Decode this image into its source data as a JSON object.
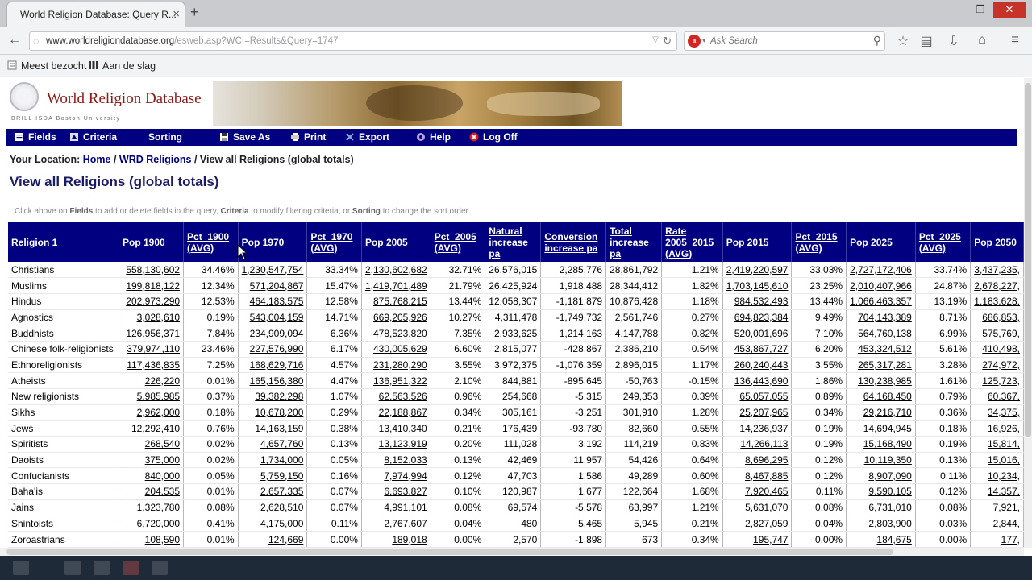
{
  "browser": {
    "tab_title": "World Religion Database: Query R...",
    "url_main": "www.worldreligiondatabase.org",
    "url_rest": "/esweb.asp?WCI=Results&Query=1747",
    "search_placeholder": "Ask Search",
    "bookmarks": [
      "Meest bezocht",
      "Aan de slag"
    ]
  },
  "site": {
    "title": "World Religion Database",
    "sub": "BRILL    ISDA    Boston University"
  },
  "menu": [
    {
      "label": "Fields",
      "icon": "fields-icon"
    },
    {
      "label": "Criteria",
      "icon": "criteria-icon"
    },
    {
      "label": "Sorting",
      "icon": ""
    },
    {
      "label": "Save As",
      "icon": "save-icon"
    },
    {
      "label": "Print",
      "icon": "print-icon"
    },
    {
      "label": "Export",
      "icon": "export-icon"
    },
    {
      "label": "Help",
      "icon": "help-icon"
    },
    {
      "label": "Log Off",
      "icon": "logoff-icon"
    }
  ],
  "location": {
    "prefix": "Your Location: ",
    "home": "Home",
    "sep": " / ",
    "section": "WRD Religions",
    "current": "View all Religions (global totals)"
  },
  "page_title": "View all Religions (global totals)",
  "instructions": {
    "t1": "Click above on ",
    "b1": "Fields",
    "t2": " to add or delete fields in the query, ",
    "b2": "Criteria",
    "t3": " to modify filtering criteria, or ",
    "b3": "Sorting",
    "t4": " to change the sort order."
  },
  "table": {
    "headers": [
      "Religion 1",
      "Pop 1900",
      "Pct_1900 (AVG)",
      "Pop 1970",
      "Pct_1970 (AVG)",
      "Pop 2005",
      "Pct_2005 (AVG)",
      "Natural increase pa",
      "Conversion increase pa",
      "Total increase pa",
      "Rate 2005_2015 (AVG)",
      "Pop 2015",
      "Pct_2015 (AVG)",
      "Pop 2025",
      "Pct_2025 (AVG)",
      "Pop 2050"
    ],
    "rows": [
      [
        "Christians",
        "558,130,602",
        "34.46%",
        "1,230,547,754",
        "33.34%",
        "2,130,602,682",
        "32.71%",
        "26,576,015",
        "2,285,776",
        "28,861,792",
        "1.21%",
        "2,419,220,597",
        "33.03%",
        "2,727,172,406",
        "33.74%",
        "3,437,235,"
      ],
      [
        "Muslims",
        "199,818,122",
        "12.34%",
        "571,204,867",
        "15.47%",
        "1,419,701,489",
        "21.79%",
        "26,425,924",
        "1,918,488",
        "28,344,412",
        "1.82%",
        "1,703,145,610",
        "23.25%",
        "2,010,407,966",
        "24.87%",
        "2,678,227,"
      ],
      [
        "Hindus",
        "202,973,290",
        "12.53%",
        "464,183,575",
        "12.58%",
        "875,768,215",
        "13.44%",
        "12,058,307",
        "-1,181,879",
        "10,876,428",
        "1.18%",
        "984,532,493",
        "13.44%",
        "1,066,463,357",
        "13.19%",
        "1,183,628,"
      ],
      [
        "Agnostics",
        "3,028,610",
        "0.19%",
        "543,004,159",
        "14.71%",
        "669,205,926",
        "10.27%",
        "4,311,478",
        "-1,749,732",
        "2,561,746",
        "0.27%",
        "694,823,384",
        "9.49%",
        "704,143,389",
        "8.71%",
        "686,853,"
      ],
      [
        "Buddhists",
        "126,956,371",
        "7.84%",
        "234,909,094",
        "6.36%",
        "478,523,820",
        "7.35%",
        "2,933,625",
        "1,214,163",
        "4,147,788",
        "0.82%",
        "520,001,696",
        "7.10%",
        "564,760,138",
        "6.99%",
        "575,769,"
      ],
      [
        "Chinese folk-religionists",
        "379,974,110",
        "23.46%",
        "227,576,990",
        "6.17%",
        "430,005,629",
        "6.60%",
        "2,815,077",
        "-428,867",
        "2,386,210",
        "0.54%",
        "453,867,727",
        "6.20%",
        "453,324,512",
        "5.61%",
        "410,498,"
      ],
      [
        "Ethnoreligionists",
        "117,436,835",
        "7.25%",
        "168,629,716",
        "4.57%",
        "231,280,290",
        "3.55%",
        "3,972,375",
        "-1,076,359",
        "2,896,015",
        "1.17%",
        "260,240,443",
        "3.55%",
        "265,317,281",
        "3.28%",
        "274,972,"
      ],
      [
        "Atheists",
        "226,220",
        "0.01%",
        "165,156,380",
        "4.47%",
        "136,951,322",
        "2.10%",
        "844,881",
        "-895,645",
        "-50,763",
        "-0.15%",
        "136,443,690",
        "1.86%",
        "130,238,985",
        "1.61%",
        "125,723,"
      ],
      [
        "New religionists",
        "5,985,985",
        "0.37%",
        "39,382,298",
        "1.07%",
        "62,563,526",
        "0.96%",
        "254,668",
        "-5,315",
        "249,353",
        "0.39%",
        "65,057,055",
        "0.89%",
        "64,168,450",
        "0.79%",
        "60,367,"
      ],
      [
        "Sikhs",
        "2,962,000",
        "0.18%",
        "10,678,200",
        "0.29%",
        "22,188,867",
        "0.34%",
        "305,161",
        "-3,251",
        "301,910",
        "1.28%",
        "25,207,965",
        "0.34%",
        "29,216,710",
        "0.36%",
        "34,375,"
      ],
      [
        "Jews",
        "12,292,410",
        "0.76%",
        "14,163,159",
        "0.38%",
        "13,410,340",
        "0.21%",
        "176,439",
        "-93,780",
        "82,660",
        "0.55%",
        "14,236,937",
        "0.19%",
        "14,694,945",
        "0.18%",
        "16,926,"
      ],
      [
        "Spiritists",
        "268,540",
        "0.02%",
        "4,657,760",
        "0.13%",
        "13,123,919",
        "0.20%",
        "111,028",
        "3,192",
        "114,219",
        "0.83%",
        "14,266,113",
        "0.19%",
        "15,168,490",
        "0.19%",
        "15,814,"
      ],
      [
        "Daoists",
        "375,000",
        "0.02%",
        "1,734,000",
        "0.05%",
        "8,152,033",
        "0.13%",
        "42,469",
        "11,957",
        "54,426",
        "0.64%",
        "8,696,295",
        "0.12%",
        "10,119,350",
        "0.13%",
        "15,016,"
      ],
      [
        "Confucianists",
        "840,000",
        "0.05%",
        "5,759,150",
        "0.16%",
        "7,974,994",
        "0.12%",
        "47,703",
        "1,586",
        "49,289",
        "0.60%",
        "8,467,885",
        "0.12%",
        "8,907,090",
        "0.11%",
        "10,234,"
      ],
      [
        "Baha'is",
        "204,535",
        "0.01%",
        "2,657,335",
        "0.07%",
        "6,693,827",
        "0.10%",
        "120,987",
        "1,677",
        "122,664",
        "1.68%",
        "7,920,465",
        "0.11%",
        "9,590,105",
        "0.12%",
        "14,357,"
      ],
      [
        "Jains",
        "1,323,780",
        "0.08%",
        "2,628,510",
        "0.07%",
        "4,991,101",
        "0.08%",
        "69,574",
        "-5,578",
        "63,997",
        "1.21%",
        "5,631,070",
        "0.08%",
        "6,731,010",
        "0.08%",
        "7,921,"
      ],
      [
        "Shintoists",
        "6,720,000",
        "0.41%",
        "4,175,000",
        "0.11%",
        "2,767,607",
        "0.04%",
        "480",
        "5,465",
        "5,945",
        "0.21%",
        "2,827,059",
        "0.04%",
        "2,803,900",
        "0.03%",
        "2,844,"
      ],
      [
        "Zoroastrians",
        "108,590",
        "0.01%",
        "124,669",
        "0.00%",
        "189,018",
        "0.00%",
        "2,570",
        "-1,898",
        "673",
        "0.34%",
        "195,747",
        "0.00%",
        "184,675",
        "0.00%",
        "177,"
      ]
    ]
  },
  "colors": {
    "menubar": "#000080",
    "site_title": "#8b1a1a",
    "header_bg": "#000080"
  }
}
